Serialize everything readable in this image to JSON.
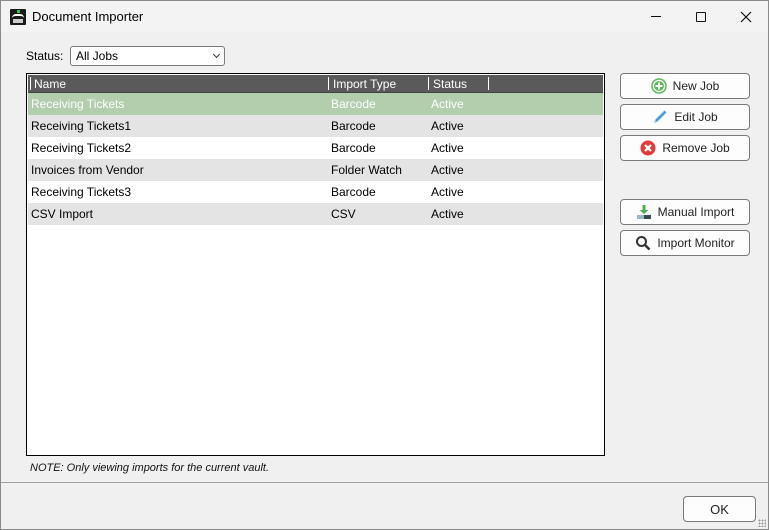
{
  "window": {
    "title": "Document Importer",
    "controls": {
      "minimize": "minimize",
      "maximize": "maximize",
      "close": "close"
    }
  },
  "filter": {
    "label": "Status:",
    "selected": "All Jobs"
  },
  "jobs_table": {
    "columns": [
      "Name",
      "Import Type",
      "Status"
    ],
    "rows": [
      {
        "name": "Receiving Tickets",
        "import_type": "Barcode",
        "status": "Active",
        "selected": true
      },
      {
        "name": "Receiving Tickets1",
        "import_type": "Barcode",
        "status": "Active",
        "selected": false
      },
      {
        "name": "Receiving Tickets2",
        "import_type": "Barcode",
        "status": "Active",
        "selected": false
      },
      {
        "name": "Invoices from Vendor",
        "import_type": "Folder Watch",
        "status": "Active",
        "selected": false
      },
      {
        "name": "Receiving Tickets3",
        "import_type": "Barcode",
        "status": "Active",
        "selected": false
      },
      {
        "name": "CSV Import",
        "import_type": "CSV",
        "status": "Active",
        "selected": false
      }
    ]
  },
  "actions": {
    "new_job": {
      "label": "New Job",
      "icon": "plus-circle-icon"
    },
    "edit_job": {
      "label": "Edit Job",
      "icon": "pencil-icon"
    },
    "remove_job": {
      "label": "Remove Job",
      "icon": "x-circle-icon"
    },
    "manual_import": {
      "label": "Manual Import",
      "icon": "download-icon"
    },
    "import_monitor": {
      "label": "Import Monitor",
      "icon": "magnifier-icon"
    }
  },
  "note": "NOTE: Only viewing imports for the current vault.",
  "footer": {
    "ok_label": "OK"
  },
  "colors": {
    "header_bg": "#5a5a5a",
    "selected_row": "#b2ceac",
    "alt_row": "#e4e4e4",
    "new_icon": "#5cb85c",
    "edit_icon": "#4a9be0",
    "remove_icon": "#e03c3c"
  }
}
